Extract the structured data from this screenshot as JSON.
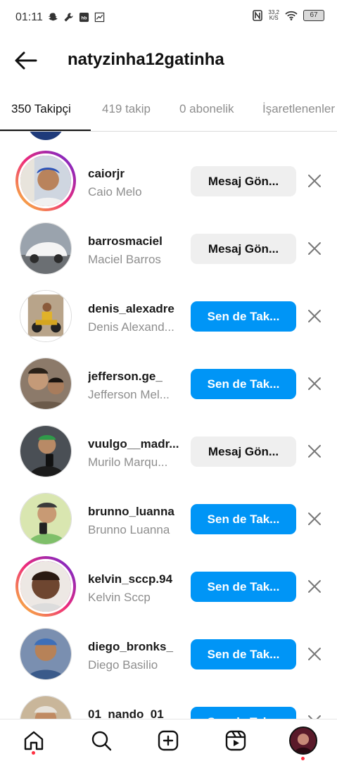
{
  "status_bar": {
    "time": "01:11",
    "network_speed_value": "33,2",
    "network_speed_unit": "K/S",
    "battery": "67",
    "left_icons": [
      "snapchat-icon",
      "wrench-icon",
      "hb-icon",
      "chart-icon"
    ],
    "right_icons": [
      "nfc-icon",
      "wifi-icon",
      "battery-icon"
    ]
  },
  "header": {
    "title": "natyzinha12gatinha",
    "back_icon": "arrow-left-icon"
  },
  "tabs": [
    {
      "label": "350 Takipçi",
      "active": true
    },
    {
      "label": "419 takip",
      "active": false
    },
    {
      "label": "0 abonelik",
      "active": false
    },
    {
      "label": "İşaretlenenler",
      "active": false
    }
  ],
  "followers": [
    {
      "username": "caiorjr",
      "full_name": "Caio Melo",
      "button": "Mesaj Gön...",
      "button_type": "message",
      "story": true
    },
    {
      "username": "barrosmaciel",
      "full_name": "Maciel Barros",
      "button": "Mesaj Gön...",
      "button_type": "message",
      "story": false
    },
    {
      "username": "denis_alexadre",
      "full_name": "Denis Alexand...",
      "button": "Sen de Tak...",
      "button_type": "follow",
      "story": false
    },
    {
      "username": "jefferson.ge_",
      "full_name": "Jefferson Mel...",
      "button": "Sen de Tak...",
      "button_type": "follow",
      "story": false
    },
    {
      "username": "vuulgo__madr...",
      "full_name": "Murilo Marqu...",
      "button": "Mesaj Gön...",
      "button_type": "message",
      "story": false
    },
    {
      "username": "brunno_luanna",
      "full_name": "Brunno Luanna",
      "button": "Sen de Tak...",
      "button_type": "follow",
      "story": false
    },
    {
      "username": "kelvin_sccp.94",
      "full_name": "Kelvin Sccp",
      "button": "Sen de Tak...",
      "button_type": "follow",
      "story": true
    },
    {
      "username": "diego_bronks_",
      "full_name": "Diego Basilio",
      "button": "Sen de Tak...",
      "button_type": "follow",
      "story": false
    },
    {
      "username": "01_nando_01",
      "full_name": "",
      "button": "Sen de Tak...",
      "button_type": "follow",
      "story": false
    }
  ],
  "bottom_nav": [
    "home-icon",
    "search-icon",
    "create-icon",
    "reels-icon",
    "profile-avatar"
  ],
  "colors": {
    "follow_button": "#0095f6",
    "message_button": "#efefef",
    "secondary_text": "#8e8e8e",
    "notification_dot": "#ff3040"
  }
}
